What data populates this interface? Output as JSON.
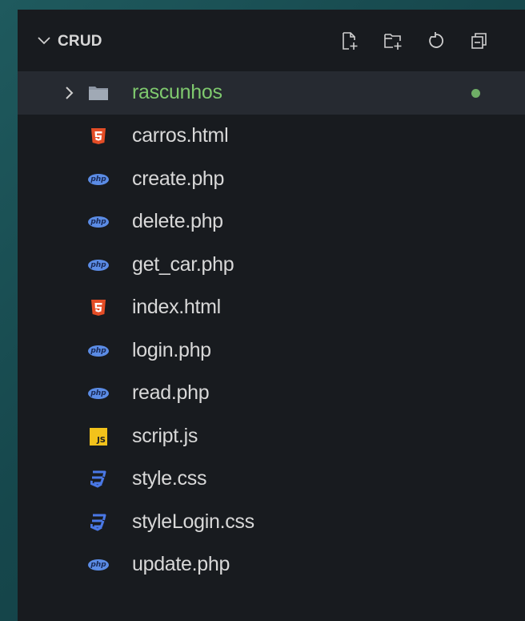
{
  "explorer": {
    "title": "CRUD",
    "actions": [
      {
        "name": "new-file-icon"
      },
      {
        "name": "new-folder-icon"
      },
      {
        "name": "refresh-icon"
      },
      {
        "name": "collapse-all-icon"
      }
    ]
  },
  "tree": {
    "folder": {
      "label": "rascunhos",
      "icon": "folder-icon",
      "status": "modified-dot",
      "label_color": "#7fc96e"
    },
    "files": [
      {
        "label": "carros.html",
        "type": "html"
      },
      {
        "label": "create.php",
        "type": "php"
      },
      {
        "label": "delete.php",
        "type": "php"
      },
      {
        "label": "get_car.php",
        "type": "php"
      },
      {
        "label": "index.html",
        "type": "html"
      },
      {
        "label": "login.php",
        "type": "php"
      },
      {
        "label": "read.php",
        "type": "php"
      },
      {
        "label": "script.js",
        "type": "js"
      },
      {
        "label": "style.css",
        "type": "css"
      },
      {
        "label": "styleLogin.css",
        "type": "css"
      },
      {
        "label": "update.php",
        "type": "php"
      }
    ]
  },
  "colors": {
    "html": "#e44d26",
    "php": "#5b8ce5",
    "js": "#f2c21b",
    "css": "#4a78e6"
  }
}
